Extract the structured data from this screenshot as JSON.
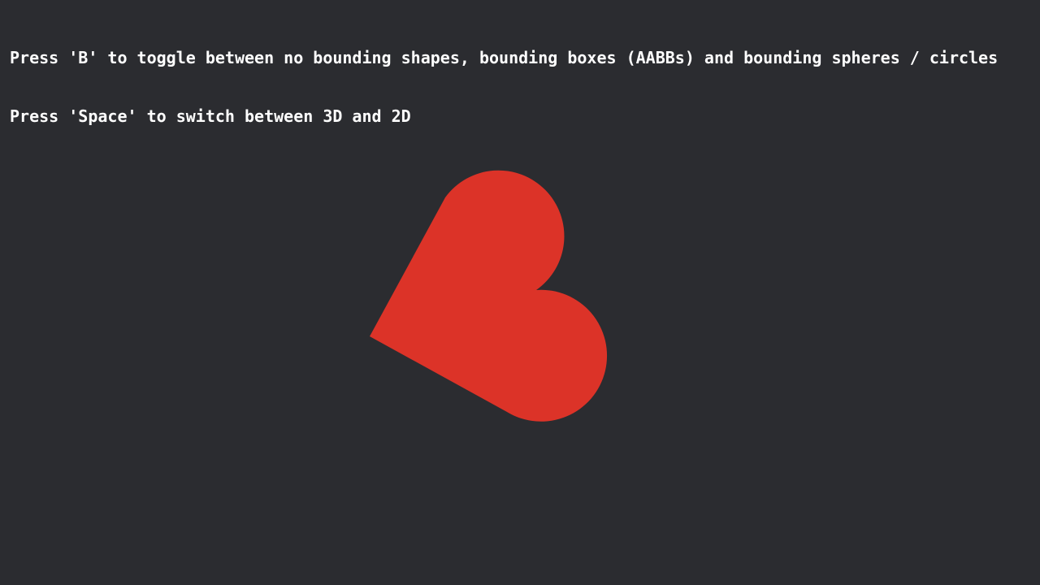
{
  "instructions": {
    "line1": "Press 'B' to toggle between no bounding shapes, bounding boxes (AABBs) and bounding spheres / circles",
    "line2": "Press 'Space' to switch between 3D and 2D"
  },
  "scene": {
    "background_color": "#2b2c30",
    "shape": {
      "name": "heart",
      "color": "#dc3328"
    }
  }
}
